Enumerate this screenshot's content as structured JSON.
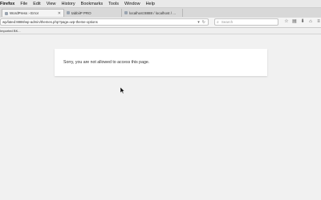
{
  "menubar": {
    "app": "Firefox",
    "items": [
      "File",
      "Edit",
      "View",
      "History",
      "Bookmarks",
      "Tools",
      "Window",
      "Help"
    ]
  },
  "tabs": [
    {
      "title": "WordPress › Error",
      "active": true
    },
    {
      "title": "tabbiiP PRO",
      "active": false
    },
    {
      "title": "localhost:8888 / localhost / ...",
      "active": false
    }
  ],
  "new_tab": "+",
  "url": "wp/​lated:8888/wp-admin/themes.php?page=wp-theme-options",
  "search": {
    "placeholder": "Search"
  },
  "bookmarks": {
    "item": "Imported BK..."
  },
  "page": {
    "message": "Sorry, you are not allowed to access this page."
  }
}
